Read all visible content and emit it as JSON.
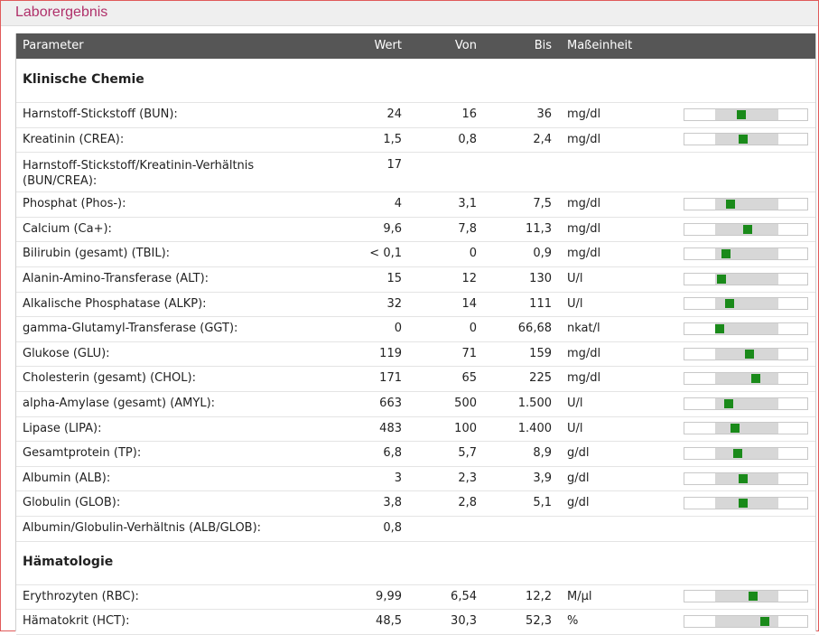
{
  "window_title": "Laborergebnis",
  "columns": {
    "parameter": "Parameter",
    "wert": "Wert",
    "von": "Von",
    "bis": "Bis",
    "unit": "Maßeinheit"
  },
  "sections": [
    {
      "title": "Klinische Chemie",
      "rows": [
        {
          "name": "Harnstoff-Stickstoff (BUN):",
          "wert": "24",
          "von": "16",
          "bis": "36",
          "unit": "mg/dl",
          "position": 0.4
        },
        {
          "name": "Kreatinin (CREA):",
          "wert": "1,5",
          "von": "0,8",
          "bis": "2,4",
          "unit": "mg/dl",
          "position": 0.44
        },
        {
          "name": "Harnstoff-Stickstoff/Kreatinin-Verhältnis (BUN/CREA):",
          "wert": "17",
          "von": "",
          "bis": "",
          "unit": "",
          "position": null
        },
        {
          "name": "Phosphat (Phos-):",
          "wert": "4",
          "von": "3,1",
          "bis": "7,5",
          "unit": "mg/dl",
          "position": 0.2
        },
        {
          "name": "Calcium (Ca+):",
          "wert": "9,6",
          "von": "7,8",
          "bis": "11,3",
          "unit": "mg/dl",
          "position": 0.51
        },
        {
          "name": "Bilirubin (gesamt) (TBIL):",
          "wert": "< 0,1",
          "von": "0",
          "bis": "0,9",
          "unit": "mg/dl",
          "position": 0.11
        },
        {
          "name": "Alanin-Amino-Transferase (ALT):",
          "wert": "15",
          "von": "12",
          "bis": "130",
          "unit": "U/l",
          "position": 0.03
        },
        {
          "name": "Alkalische Phosphatase (ALKP):",
          "wert": "32",
          "von": "14",
          "bis": "111",
          "unit": "U/l",
          "position": 0.19
        },
        {
          "name": "gamma-Glutamyl-Transferase (GGT):",
          "wert": "0",
          "von": "0",
          "bis": "66,68",
          "unit": "nkat/l",
          "position": 0.0
        },
        {
          "name": "Glukose (GLU):",
          "wert": "119",
          "von": "71",
          "bis": "159",
          "unit": "mg/dl",
          "position": 0.55
        },
        {
          "name": "Cholesterin (gesamt) (CHOL):",
          "wert": "171",
          "von": "65",
          "bis": "225",
          "unit": "mg/dl",
          "position": 0.66
        },
        {
          "name": "alpha-Amylase (gesamt) (AMYL):",
          "wert": "663",
          "von": "500",
          "bis": "1.500",
          "unit": "U/l",
          "position": 0.16
        },
        {
          "name": "Lipase (LIPA):",
          "wert": "483",
          "von": "100",
          "bis": "1.400",
          "unit": "U/l",
          "position": 0.29
        },
        {
          "name": "Gesamtprotein (TP):",
          "wert": "6,8",
          "von": "5,7",
          "bis": "8,9",
          "unit": "g/dl",
          "position": 0.34
        },
        {
          "name": "Albumin (ALB):",
          "wert": "3",
          "von": "2,3",
          "bis": "3,9",
          "unit": "g/dl",
          "position": 0.44
        },
        {
          "name": "Globulin (GLOB):",
          "wert": "3,8",
          "von": "2,8",
          "bis": "5,1",
          "unit": "g/dl",
          "position": 0.43
        },
        {
          "name": "Albumin/Globulin-Verhältnis (ALB/GLOB):",
          "wert": "0,8",
          "von": "",
          "bis": "",
          "unit": "",
          "position": null
        }
      ]
    },
    {
      "title": "Hämatologie",
      "rows": [
        {
          "name": "Erythrozyten (RBC):",
          "wert": "9,99",
          "von": "6,54",
          "bis": "12,2",
          "unit": "M/µl",
          "position": 0.61
        },
        {
          "name": "Hämatokrit (HCT):",
          "wert": "48,5",
          "von": "30,3",
          "bis": "52,3",
          "unit": "%",
          "position": 0.83
        }
      ]
    }
  ],
  "colors": {
    "title": "#b0306a",
    "header_bg": "#565656",
    "marker": "#1a8a1a",
    "normal_range": "#d7d7d7"
  }
}
